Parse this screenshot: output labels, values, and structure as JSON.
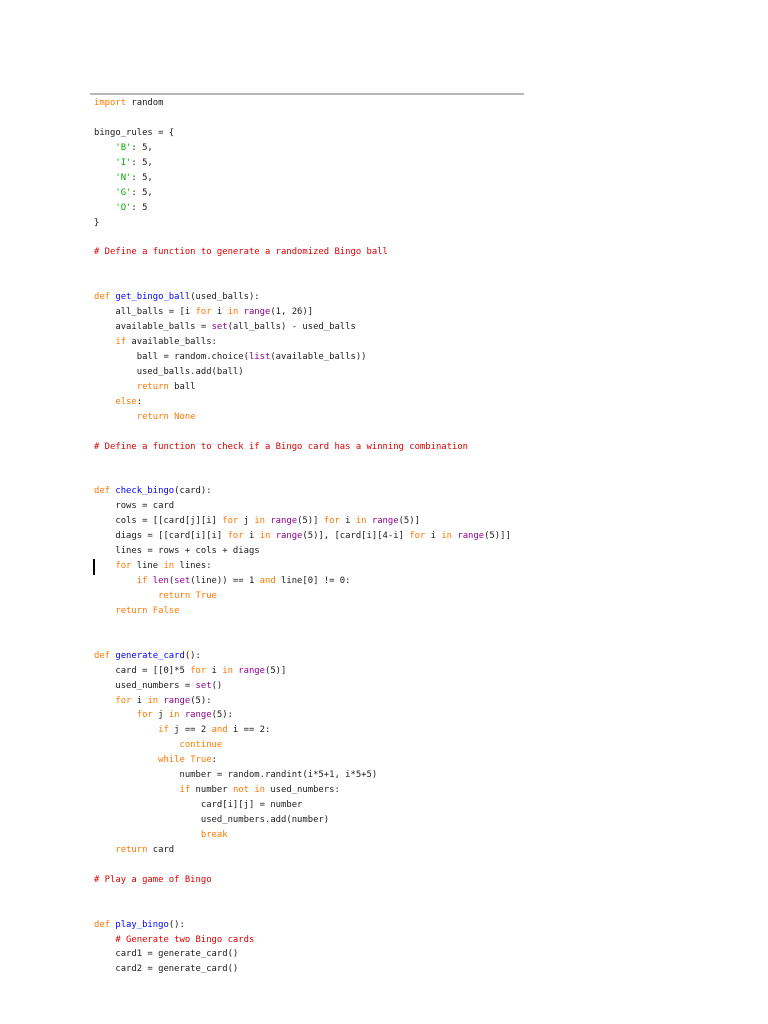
{
  "document": {
    "code_lines": [
      [
        [
          "import",
          "kw"
        ],
        [
          " random",
          ""
        ]
      ],
      [],
      [
        [
          "bingo_rules = {",
          ""
        ]
      ],
      [
        [
          "    ",
          ""
        ],
        [
          "'B'",
          "str"
        ],
        [
          ": 5,",
          ""
        ]
      ],
      [
        [
          "    ",
          ""
        ],
        [
          "'I'",
          "str"
        ],
        [
          ": 5,",
          ""
        ]
      ],
      [
        [
          "    ",
          ""
        ],
        [
          "'N'",
          "str"
        ],
        [
          ": 5,",
          ""
        ]
      ],
      [
        [
          "    ",
          ""
        ],
        [
          "'G'",
          "str"
        ],
        [
          ": 5,",
          ""
        ]
      ],
      [
        [
          "    ",
          ""
        ],
        [
          "'O'",
          "str"
        ],
        [
          ": 5",
          ""
        ]
      ],
      [
        [
          "}",
          ""
        ]
      ],
      [],
      [
        [
          "# Define a function to generate a randomized Bingo ball",
          "cm"
        ]
      ],
      [],
      [],
      [
        [
          "def",
          "kw"
        ],
        [
          " ",
          ""
        ],
        [
          "get_bingo_ball",
          "fn"
        ],
        [
          "(used_balls):",
          ""
        ]
      ],
      [
        [
          "    all_balls = [i ",
          ""
        ],
        [
          "for",
          "kw"
        ],
        [
          " i ",
          ""
        ],
        [
          "in",
          "kw"
        ],
        [
          " ",
          ""
        ],
        [
          "range",
          "bi"
        ],
        [
          "(1, 26)]",
          ""
        ]
      ],
      [
        [
          "    available_balls = ",
          ""
        ],
        [
          "set",
          "bi"
        ],
        [
          "(all_balls) - used_balls",
          ""
        ]
      ],
      [
        [
          "    ",
          ""
        ],
        [
          "if",
          "kw"
        ],
        [
          " available_balls:",
          ""
        ]
      ],
      [
        [
          "        ball = random.choice(",
          ""
        ],
        [
          "list",
          "bi"
        ],
        [
          "(available_balls))",
          ""
        ]
      ],
      [
        [
          "        used_balls.add(ball)",
          ""
        ]
      ],
      [
        [
          "        ",
          ""
        ],
        [
          "return",
          "kw"
        ],
        [
          " ball",
          ""
        ]
      ],
      [
        [
          "    ",
          ""
        ],
        [
          "else",
          "kw"
        ],
        [
          ":",
          ""
        ]
      ],
      [
        [
          "        ",
          ""
        ],
        [
          "return",
          "kw"
        ],
        [
          " ",
          ""
        ],
        [
          "None",
          "kw"
        ]
      ],
      [],
      [
        [
          "# Define a function to check if a Bingo card has a winning combination",
          "cm"
        ]
      ],
      [],
      [],
      [
        [
          "def",
          "kw"
        ],
        [
          " ",
          ""
        ],
        [
          "check_bingo",
          "fn"
        ],
        [
          "(card):",
          ""
        ]
      ],
      [
        [
          "    rows = card",
          ""
        ]
      ],
      [
        [
          "    cols = [[card[j][i] ",
          ""
        ],
        [
          "for",
          "kw"
        ],
        [
          " j ",
          ""
        ],
        [
          "in",
          "kw"
        ],
        [
          " ",
          ""
        ],
        [
          "range",
          "bi"
        ],
        [
          "(5)] ",
          ""
        ],
        [
          "for",
          "kw"
        ],
        [
          " i ",
          ""
        ],
        [
          "in",
          "kw"
        ],
        [
          " ",
          ""
        ],
        [
          "range",
          "bi"
        ],
        [
          "(5)]",
          ""
        ]
      ],
      [
        [
          "    diags = [[card[i][i] ",
          ""
        ],
        [
          "for",
          "kw"
        ],
        [
          " i ",
          ""
        ],
        [
          "in",
          "kw"
        ],
        [
          " ",
          ""
        ],
        [
          "range",
          "bi"
        ],
        [
          "(5)], [card[i][4-i] ",
          ""
        ],
        [
          "for",
          "kw"
        ],
        [
          " i ",
          ""
        ],
        [
          "in",
          "kw"
        ],
        [
          " ",
          ""
        ],
        [
          "range",
          "bi"
        ],
        [
          "(5)]]",
          ""
        ]
      ],
      [
        [
          "    lines = rows + cols + diags",
          ""
        ]
      ],
      [
        [
          "    ",
          ""
        ],
        [
          "for",
          "kw"
        ],
        [
          " line ",
          ""
        ],
        [
          "in",
          "kw"
        ],
        [
          " lines:",
          ""
        ]
      ],
      [
        [
          "        ",
          ""
        ],
        [
          "if",
          "kw"
        ],
        [
          " ",
          ""
        ],
        [
          "len",
          "bi"
        ],
        [
          "(",
          ""
        ],
        [
          "set",
          "bi"
        ],
        [
          "(line)) == 1 ",
          ""
        ],
        [
          "and",
          "kw"
        ],
        [
          " line[0] != 0:",
          ""
        ]
      ],
      [
        [
          "            ",
          ""
        ],
        [
          "return",
          "kw"
        ],
        [
          " ",
          ""
        ],
        [
          "True",
          "kw"
        ]
      ],
      [
        [
          "    ",
          ""
        ],
        [
          "return",
          "kw"
        ],
        [
          " ",
          ""
        ],
        [
          "False",
          "kw"
        ]
      ],
      [],
      [],
      [
        [
          "def",
          "kw"
        ],
        [
          " ",
          ""
        ],
        [
          "generate_card",
          "fn"
        ],
        [
          "():",
          ""
        ]
      ],
      [
        [
          "    card = [[0]*5 ",
          ""
        ],
        [
          "for",
          "kw"
        ],
        [
          " i ",
          ""
        ],
        [
          "in",
          "kw"
        ],
        [
          " ",
          ""
        ],
        [
          "range",
          "bi"
        ],
        [
          "(5)]",
          ""
        ]
      ],
      [
        [
          "    used_numbers = ",
          ""
        ],
        [
          "set",
          "bi"
        ],
        [
          "()",
          ""
        ]
      ],
      [
        [
          "    ",
          ""
        ],
        [
          "for",
          "kw"
        ],
        [
          " i ",
          ""
        ],
        [
          "in",
          "kw"
        ],
        [
          " ",
          ""
        ],
        [
          "range",
          "bi"
        ],
        [
          "(5):",
          ""
        ]
      ],
      [
        [
          "        ",
          ""
        ],
        [
          "for",
          "kw"
        ],
        [
          " j ",
          ""
        ],
        [
          "in",
          "kw"
        ],
        [
          " ",
          ""
        ],
        [
          "range",
          "bi"
        ],
        [
          "(5):",
          ""
        ]
      ],
      [
        [
          "            ",
          ""
        ],
        [
          "if",
          "kw"
        ],
        [
          " j == 2 ",
          ""
        ],
        [
          "and",
          "kw"
        ],
        [
          " i == 2:",
          ""
        ]
      ],
      [
        [
          "                ",
          ""
        ],
        [
          "continue",
          "kw"
        ]
      ],
      [
        [
          "            ",
          ""
        ],
        [
          "while",
          "kw"
        ],
        [
          " ",
          ""
        ],
        [
          "True",
          "kw"
        ],
        [
          ":",
          ""
        ]
      ],
      [
        [
          "                number = random.randint(i*5+1, i*5+5)",
          ""
        ]
      ],
      [
        [
          "                ",
          ""
        ],
        [
          "if",
          "kw"
        ],
        [
          " number ",
          ""
        ],
        [
          "not",
          "kw"
        ],
        [
          " ",
          ""
        ],
        [
          "in",
          "kw"
        ],
        [
          " used_numbers:",
          ""
        ]
      ],
      [
        [
          "                    card[i][j] = number",
          ""
        ]
      ],
      [
        [
          "                    used_numbers.add(number)",
          ""
        ]
      ],
      [
        [
          "                    ",
          ""
        ],
        [
          "break",
          "kw"
        ]
      ],
      [
        [
          "    ",
          ""
        ],
        [
          "return",
          "kw"
        ],
        [
          " card",
          ""
        ]
      ],
      [],
      [
        [
          "# Play a game of Bingo",
          "cm"
        ]
      ],
      [],
      [],
      [
        [
          "def",
          "kw"
        ],
        [
          " ",
          ""
        ],
        [
          "play_bingo",
          "fn"
        ],
        [
          "():",
          ""
        ]
      ],
      [
        [
          "    ",
          ""
        ],
        [
          "# Generate two Bingo cards",
          "cm"
        ]
      ],
      [
        [
          "    card1 = generate_card()",
          ""
        ]
      ],
      [
        [
          "    card2 = generate_card()",
          ""
        ]
      ]
    ]
  },
  "colors": {
    "keyword": "#ff7700",
    "builtin": "#900090",
    "string": "#00aa00",
    "comment": "#dd0000",
    "function_name": "#0000ff"
  }
}
